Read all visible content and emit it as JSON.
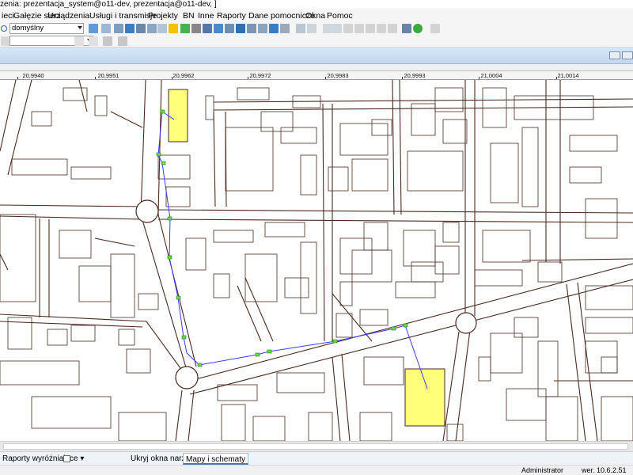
{
  "window": {
    "title": "zenia: prezentacja_system@o11-dev, prezentacja@o11-dev, ]"
  },
  "menu": {
    "items": [
      "ieci",
      "Gałęzie sieci",
      "Urządzenia",
      "Usługi i transmisje",
      "Projekty",
      "BN",
      "Inne",
      "Raporty",
      "Dane pomocnicze",
      "Okna",
      "Pomoc"
    ]
  },
  "toolbar": {
    "style_combo_value": "domyślny",
    "style_combo_placeholder": ""
  },
  "ruler": {
    "ticks": [
      "20,9940",
      "20,9951",
      "20,9962",
      "20,9972",
      "20,9983",
      "20,9993",
      "21,0004",
      "21,0014"
    ]
  },
  "map": {
    "feature_colors": {
      "road": "#4a2a20",
      "building_outline": "#4a2a20",
      "highlight_fill": "#ffff7a",
      "route_line": "#3a3aff",
      "route_node": "#66dd44"
    }
  },
  "statusbar": {
    "reports_label": "Raporty wyróżniające",
    "hide_tools_label": "Ukryj okna narzędzi",
    "maps_tab_label": "Mapy i schematy"
  },
  "bottombar": {
    "user": "Administrator",
    "version": "wer. 10.6.2.51"
  },
  "colors": {
    "accent": "#4a78b5",
    "docbar": "#c8dcf0"
  }
}
